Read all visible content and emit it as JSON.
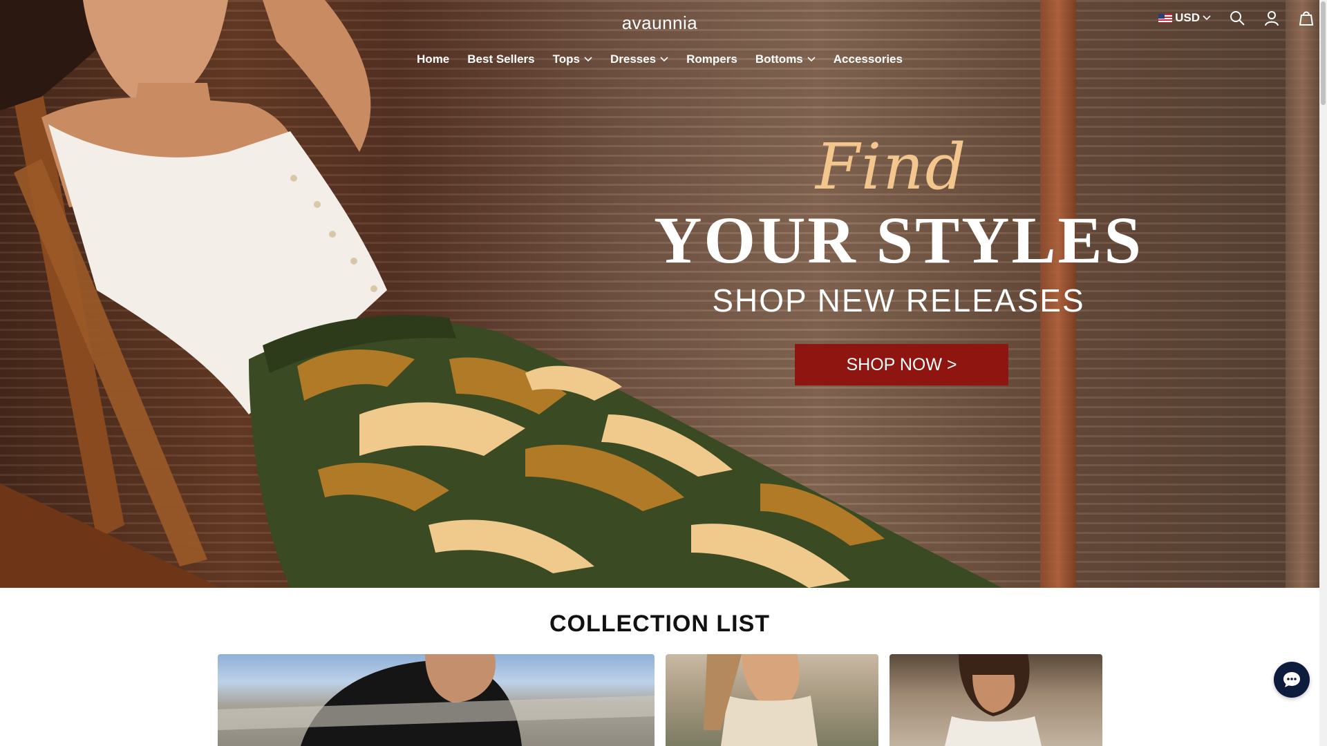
{
  "header": {
    "logo": "avaunnia",
    "currency": "USD",
    "icons": [
      "search-icon",
      "account-icon",
      "cart-icon",
      "us-flag-icon"
    ]
  },
  "nav": {
    "items": [
      {
        "label": "Home",
        "dropdown": false
      },
      {
        "label": "Best Sellers",
        "dropdown": false
      },
      {
        "label": "Tops",
        "dropdown": true
      },
      {
        "label": "Dresses",
        "dropdown": true
      },
      {
        "label": "Rompers",
        "dropdown": false
      },
      {
        "label": "Bottoms",
        "dropdown": true
      },
      {
        "label": "Accessories",
        "dropdown": false
      }
    ]
  },
  "hero": {
    "script_word": "Find",
    "headline": "YOUR STYLES",
    "subline": "SHOP NEW RELEASES",
    "cta": "SHOP NOW >"
  },
  "collection": {
    "title": "COLLECTION LIST"
  },
  "colors": {
    "cta_background": "#8e1510",
    "script_accent": "#f3c68e",
    "chat_button": "#0d1b3d"
  },
  "chat": {
    "icon": "chat-bubble-icon"
  }
}
